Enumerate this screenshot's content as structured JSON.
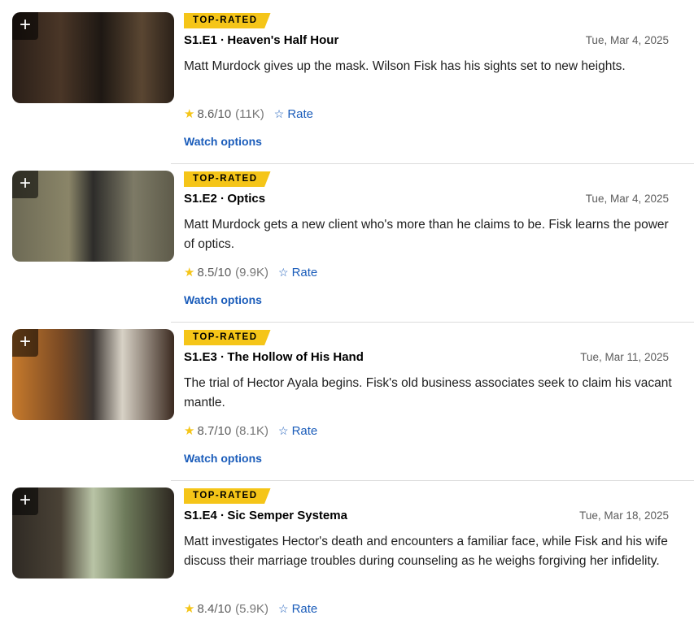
{
  "episodes": [
    {
      "badge": "TOP-RATED",
      "title": "S1.E1 ∙ Heaven's Half Hour",
      "date": "Tue, Mar 4, 2025",
      "description": "Matt Murdock gives up the mask. Wilson Fisk has his sights set to new heights.",
      "rating": "8.6",
      "rating_max": "/10",
      "votes": "(11K)",
      "rate_label": "Rate",
      "watch_label": "Watch options"
    },
    {
      "badge": "TOP-RATED",
      "title": "S1.E2 ∙ Optics",
      "date": "Tue, Mar 4, 2025",
      "description": "Matt Murdock gets a new client who's more than he claims to be. Fisk learns the power of optics.",
      "rating": "8.5",
      "rating_max": "/10",
      "votes": "(9.9K)",
      "rate_label": "Rate",
      "watch_label": "Watch options"
    },
    {
      "badge": "TOP-RATED",
      "title": "S1.E3 ∙ The Hollow of His Hand",
      "date": "Tue, Mar 11, 2025",
      "description": "The trial of Hector Ayala begins. Fisk's old business associates seek to claim his vacant mantle.",
      "rating": "8.7",
      "rating_max": "/10",
      "votes": "(8.1K)",
      "rate_label": "Rate",
      "watch_label": "Watch options"
    },
    {
      "badge": "TOP-RATED",
      "title": "S1.E4 ∙ Sic Semper Systema",
      "date": "Tue, Mar 18, 2025",
      "description": "Matt investigates Hector's death and encounters a familiar face, while Fisk and his wife discuss their marriage troubles during counseling as he weighs forgiving her infidelity.",
      "rating": "8.4",
      "rating_max": "/10",
      "votes": "(5.9K)",
      "rate_label": "Rate",
      "watch_label": ""
    }
  ],
  "plus_symbol": "+",
  "colors": {
    "accent": "#f5c518",
    "link": "#1a5cba"
  }
}
